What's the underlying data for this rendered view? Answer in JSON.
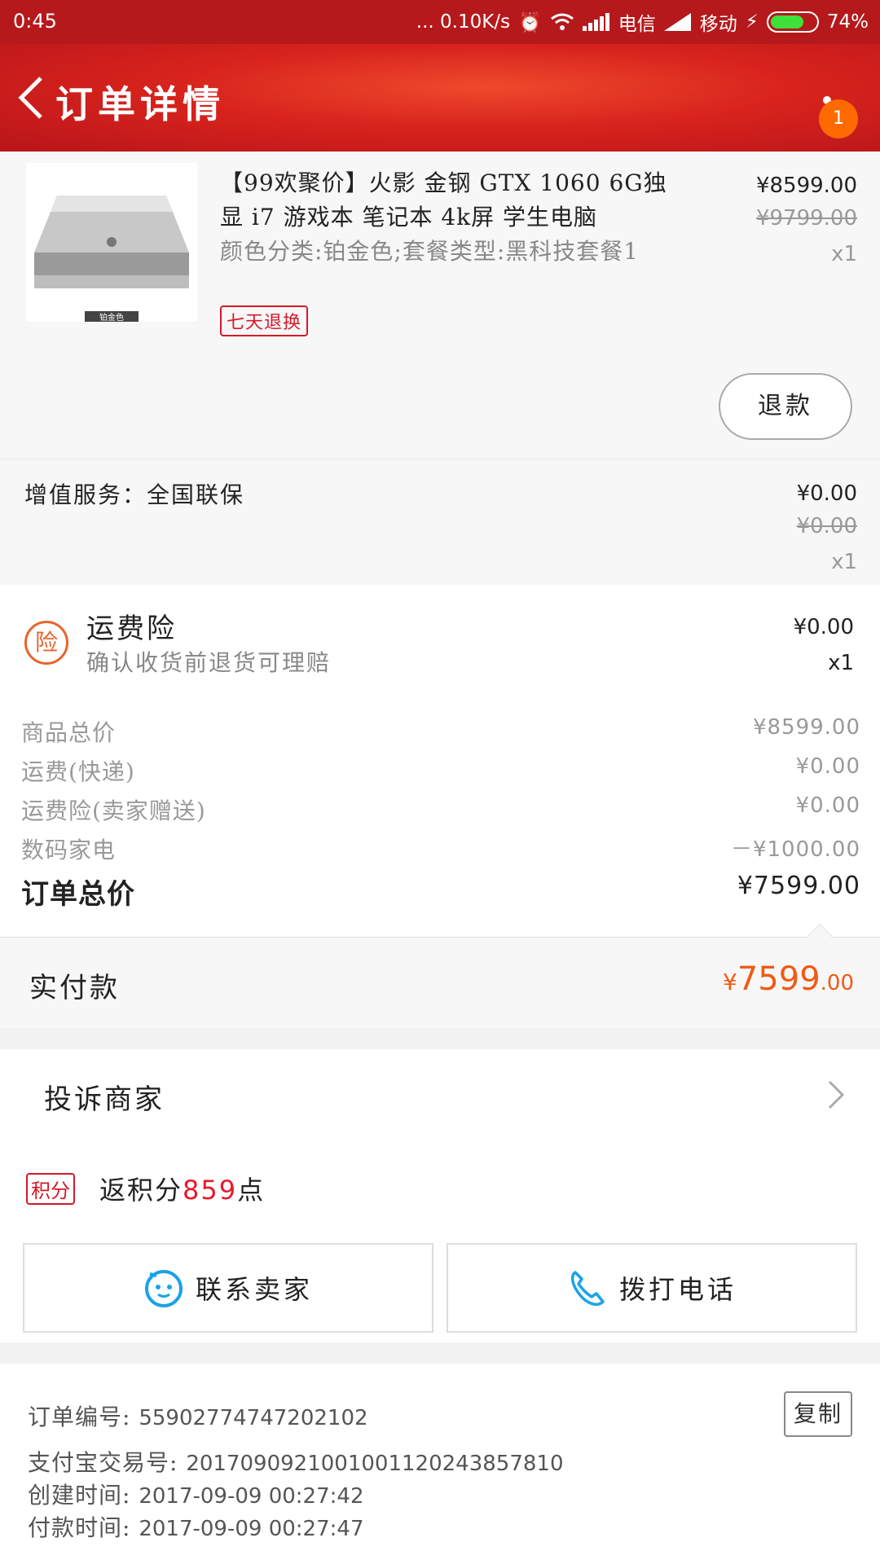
{
  "status_bar": {
    "time": "0:45",
    "speed": "... 0.10K/s",
    "carrier1": "电信",
    "carrier2": "移动",
    "battery": "74%"
  },
  "header": {
    "title": "订单详情",
    "badge": "1"
  },
  "product": {
    "title": "【99欢聚价】火影 金钢 GTX 1060 6G独显 i7 游戏本 笔记本 4k屏 学生电脑",
    "spec": "颜色分类:铂金色;套餐类型:黑科技套餐1",
    "return_tag": "七天退换",
    "price_now": "¥8599.00",
    "price_old": "¥9799.00",
    "qty": "x1",
    "refund_label": "退款",
    "thumb_caption": "铂金色"
  },
  "value_added": {
    "label": "增值服务：全国联保",
    "price_now": "¥0.00",
    "price_old": "¥0.00",
    "qty": "x1"
  },
  "insurance": {
    "icon_char": "险",
    "title": "运费险",
    "subtitle": "确认收货前退货可理赔",
    "price": "¥0.00",
    "qty": "x1"
  },
  "summary": {
    "goods_label": "商品总价",
    "goods_value": "¥8599.00",
    "shipping_label": "运费(快递)",
    "shipping_value": "¥0.00",
    "ins_label": "运费险(卖家赠送)",
    "ins_value": "¥0.00",
    "discount_label": "数码家电",
    "discount_value": "－¥1000.00",
    "total_label": "订单总价",
    "total_value": "¥7599.00"
  },
  "paid": {
    "label": "实付款",
    "currency": "¥",
    "integer": "7599",
    "decimal": ".00"
  },
  "complain": {
    "label": "投诉商家"
  },
  "points": {
    "tag": "积分",
    "prefix": "返积分",
    "value": "859",
    "suffix": "点"
  },
  "actions": {
    "contact_seller": "联系卖家",
    "call": "拨打电话"
  },
  "order_info": {
    "order_no_label": "订单编号:",
    "order_no": "55902774747202102",
    "alipay_label": "支付宝交易号:",
    "alipay_no": "2017090921001001120243857810",
    "created_label": "创建时间:",
    "created": "2017-09-09 00:27:42",
    "paid_label": "付款时间:",
    "paid_time": "2017-09-09 00:27:47",
    "copy_label": "复制"
  },
  "colors": {
    "brand_red": "#d8231d",
    "accent_orange": "#f05a14",
    "tag_red": "#d4192a",
    "blue": "#1aa3e8"
  }
}
